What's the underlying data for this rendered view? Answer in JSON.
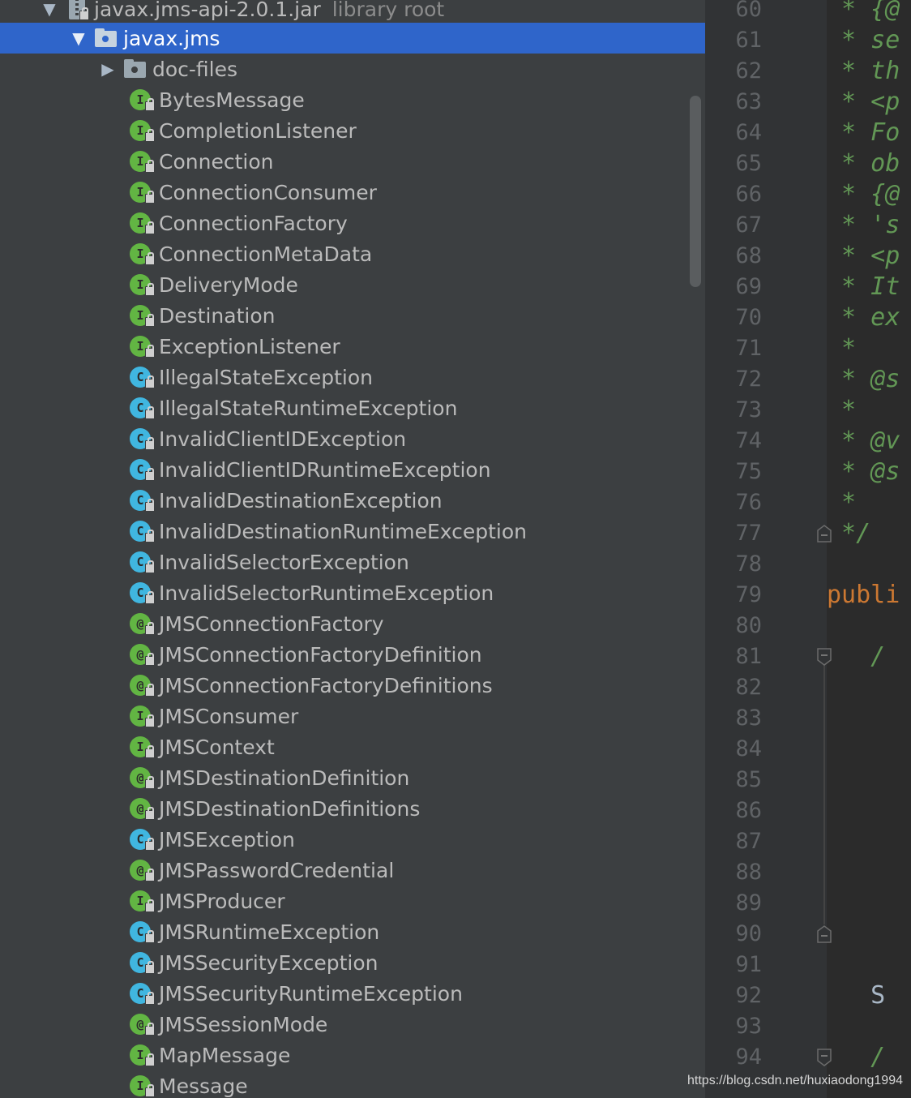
{
  "project_tree": {
    "root": {
      "label": "javax.jms-api-2.0.1.jar",
      "suffix": "library root"
    },
    "package": {
      "label": "javax.jms"
    },
    "folder": {
      "label": "doc-files"
    },
    "items": [
      {
        "label": "BytesMessage",
        "kind": "I"
      },
      {
        "label": "CompletionListener",
        "kind": "I"
      },
      {
        "label": "Connection",
        "kind": "I"
      },
      {
        "label": "ConnectionConsumer",
        "kind": "I"
      },
      {
        "label": "ConnectionFactory",
        "kind": "I"
      },
      {
        "label": "ConnectionMetaData",
        "kind": "I"
      },
      {
        "label": "DeliveryMode",
        "kind": "I"
      },
      {
        "label": "Destination",
        "kind": "I"
      },
      {
        "label": "ExceptionListener",
        "kind": "I"
      },
      {
        "label": "IllegalStateException",
        "kind": "C"
      },
      {
        "label": "IllegalStateRuntimeException",
        "kind": "C"
      },
      {
        "label": "InvalidClientIDException",
        "kind": "C"
      },
      {
        "label": "InvalidClientIDRuntimeException",
        "kind": "C"
      },
      {
        "label": "InvalidDestinationException",
        "kind": "C"
      },
      {
        "label": "InvalidDestinationRuntimeException",
        "kind": "C"
      },
      {
        "label": "InvalidSelectorException",
        "kind": "C"
      },
      {
        "label": "InvalidSelectorRuntimeException",
        "kind": "C"
      },
      {
        "label": "JMSConnectionFactory",
        "kind": "@"
      },
      {
        "label": "JMSConnectionFactoryDefinition",
        "kind": "@"
      },
      {
        "label": "JMSConnectionFactoryDefinitions",
        "kind": "@"
      },
      {
        "label": "JMSConsumer",
        "kind": "I"
      },
      {
        "label": "JMSContext",
        "kind": "I"
      },
      {
        "label": "JMSDestinationDefinition",
        "kind": "@"
      },
      {
        "label": "JMSDestinationDefinitions",
        "kind": "@"
      },
      {
        "label": "JMSException",
        "kind": "C"
      },
      {
        "label": "JMSPasswordCredential",
        "kind": "@"
      },
      {
        "label": "JMSProducer",
        "kind": "I"
      },
      {
        "label": "JMSRuntimeException",
        "kind": "C"
      },
      {
        "label": "JMSSecurityException",
        "kind": "C"
      },
      {
        "label": "JMSSecurityRuntimeException",
        "kind": "C"
      },
      {
        "label": "JMSSessionMode",
        "kind": "@"
      },
      {
        "label": "MapMessage",
        "kind": "I"
      },
      {
        "label": "Message",
        "kind": "I"
      }
    ]
  },
  "editor": {
    "line_numbers": [
      "60",
      "61",
      "62",
      "63",
      "64",
      "65",
      "66",
      "67",
      "68",
      "69",
      "70",
      "71",
      "72",
      "73",
      "74",
      "75",
      "76",
      "77",
      "78",
      "79",
      "80",
      "81",
      "82",
      "83",
      "84",
      "85",
      "86",
      "87",
      "88",
      "89",
      "90",
      "91",
      "92",
      "93",
      "94"
    ],
    "code_lines": [
      {
        "text": " * {@",
        "style": "doc"
      },
      {
        "text": " * se",
        "style": "doc"
      },
      {
        "text": " * th",
        "style": "doc"
      },
      {
        "text": " * <p",
        "style": "doc"
      },
      {
        "text": " * Fo",
        "style": "doc"
      },
      {
        "text": " * ob",
        "style": "doc"
      },
      {
        "text": " * {@",
        "style": "doc"
      },
      {
        "text": " * 's",
        "style": "doc"
      },
      {
        "text": " * <p",
        "style": "doc"
      },
      {
        "text": " * It",
        "style": "doc"
      },
      {
        "text": " * ex",
        "style": "doc"
      },
      {
        "text": " *",
        "style": "doc"
      },
      {
        "text": " * @s",
        "style": "tag"
      },
      {
        "text": " *",
        "style": "doc"
      },
      {
        "text": " * @v",
        "style": "tag"
      },
      {
        "text": " * @s",
        "style": "tag"
      },
      {
        "text": " *",
        "style": "doc"
      },
      {
        "text": " */",
        "style": "doc"
      },
      {
        "text": "",
        "style": "doc"
      },
      {
        "text": "publi",
        "style": "kw"
      },
      {
        "text": "",
        "style": "doc"
      },
      {
        "text": "   /",
        "style": "doc"
      },
      {
        "text": "",
        "style": "doc"
      },
      {
        "text": "",
        "style": "doc"
      },
      {
        "text": "",
        "style": "doc"
      },
      {
        "text": "",
        "style": "doc"
      },
      {
        "text": "",
        "style": "doc"
      },
      {
        "text": "",
        "style": "doc"
      },
      {
        "text": "",
        "style": "doc"
      },
      {
        "text": "",
        "style": "doc"
      },
      {
        "text": "",
        "style": "doc"
      },
      {
        "text": "",
        "style": "doc"
      },
      {
        "text": "   S",
        "style": "id"
      },
      {
        "text": "",
        "style": "doc"
      },
      {
        "text": "   /",
        "style": "doc"
      }
    ]
  },
  "watermark": "https://blog.csdn.net/huxiaodong1994",
  "colors": {
    "tree_bg": "#3c3f41",
    "selection": "#2f65ca",
    "interface_icon": "#62b543",
    "class_icon": "#40b6e0",
    "doc_comment": "#629755",
    "keyword": "#cc7832"
  }
}
